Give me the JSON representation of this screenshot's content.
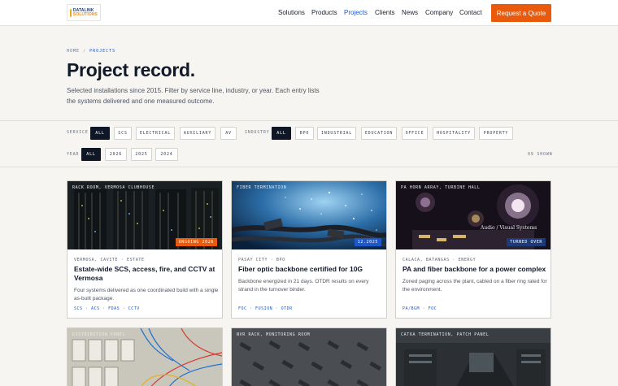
{
  "header": {
    "logo_line1": "DATALINK",
    "logo_line2": "SOLUTIONS",
    "nav": [
      "Solutions",
      "Products",
      "Projects",
      "Clients",
      "News",
      "Company",
      "Contact"
    ],
    "active_nav": "Projects",
    "cta_label": "Request a Quote",
    "brand_color": "#ea5a0c",
    "accent_color": "#1e57c7"
  },
  "breadcrumb": {
    "home": "HOME",
    "separator": "/",
    "current": "PROJECTS"
  },
  "hero": {
    "title": "Project record.",
    "intro": "Selected installations since 2015. Filter by service line, industry, or year. Each entry lists the systems delivered and one measured outcome."
  },
  "filters": {
    "service_label": "SERVICE",
    "service_options": [
      "ALL",
      "SCS",
      "ELECTRICAL",
      "AUXILIARY",
      "AV"
    ],
    "industry_label": "INDUSTRY",
    "industry_options": [
      "ALL",
      "BPO",
      "INDUSTRIAL",
      "EDUCATION",
      "OFFICE",
      "HOSPITALITY",
      "PROPERTY"
    ],
    "year_label": "YEAR",
    "year_options": [
      "ALL",
      "2026",
      "2025",
      "2024"
    ],
    "selected": {
      "service": "ALL",
      "industry": "ALL",
      "year": "ALL"
    },
    "shown_count": "09 SHOWN"
  },
  "projects": [
    {
      "caption": "RACK ROOM, VERMOSA CLUBHOUSE",
      "status": "ONGOING 2026",
      "status_color": "#ea5a0c",
      "meta": "VERMOSA, CAVITE · ESTATE",
      "title": "Estate-wide SCS, access, fire, and CCTV at Vermosa",
      "description": "Four systems delivered as one coordinated build with a single as-built package.",
      "tags": "SCS · ACS · FDAS · CCTV"
    },
    {
      "caption": "FIBER TERMINATION",
      "status": "12.2025",
      "status_color": "#1e57c7",
      "meta": "PASAY CITY · BPO",
      "title": "Fiber optic backbone certified for 10G",
      "description": "Backbone energized in 21 days. OTDR results on every strand in the turnover binder.",
      "tags": "FOC · FUSION · OTDR"
    },
    {
      "caption": "PA HORN ARRAY, TURBINE HALL",
      "status": "TURNED OVER",
      "status_color": "#1d3a78",
      "photo_text": "Audio / Visual Systems",
      "meta": "CALACA, BATANGAS · ENERGY",
      "title": "PA and fiber backbone for a power complex",
      "description": "Zoned paging across the plant, cabled on a fiber ring rated for the environment.",
      "tags": "PA/BGM · FOC"
    },
    {
      "caption": "DISTRIBUTION PANEL"
    },
    {
      "caption": "NVR RACK, MONITORING ROOM"
    },
    {
      "caption": "CAT6A TERMINATION, PATCH PANEL"
    }
  ]
}
